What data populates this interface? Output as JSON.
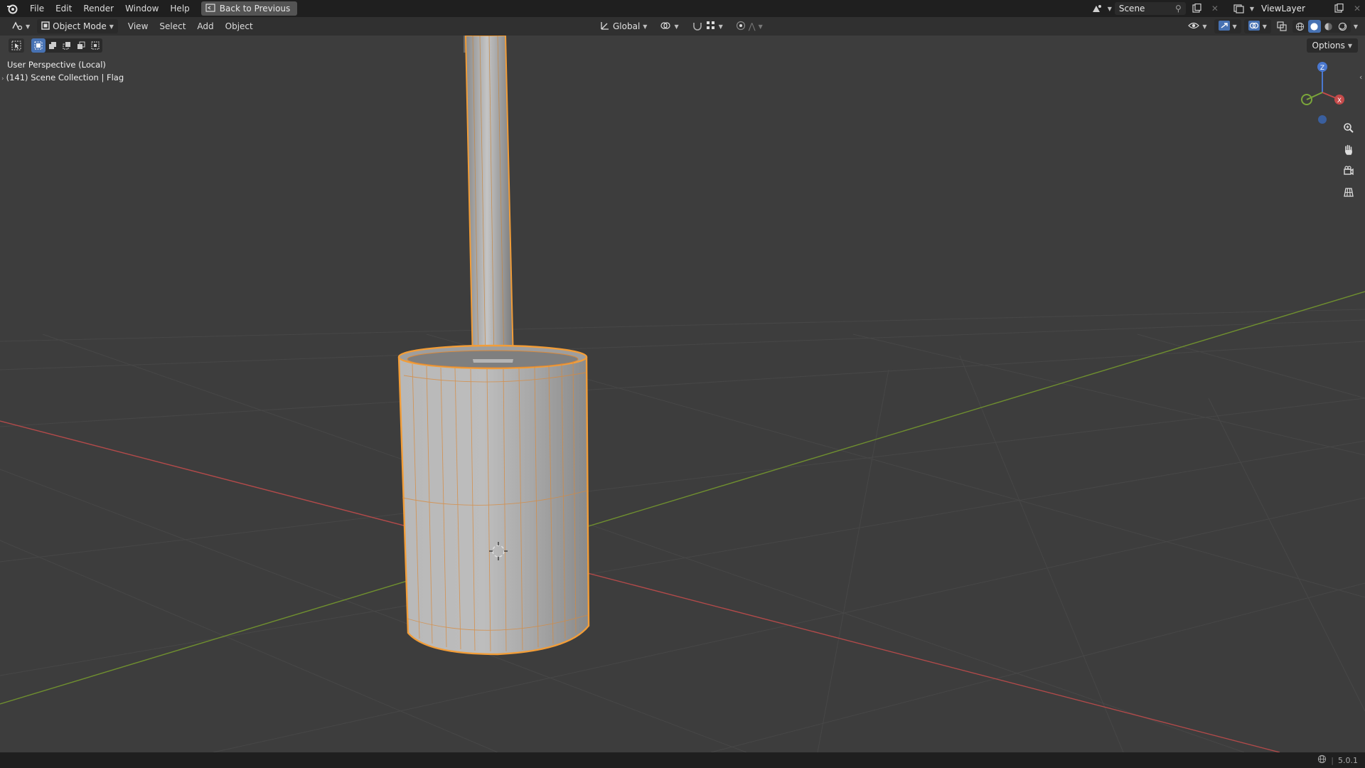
{
  "topbar": {
    "menus": [
      "File",
      "Edit",
      "Render",
      "Window",
      "Help"
    ],
    "back_label": "Back to Previous",
    "scene_name": "Scene",
    "view_layer": "ViewLayer"
  },
  "header": {
    "mode": "Object Mode",
    "menus": [
      "View",
      "Select",
      "Add",
      "Object"
    ],
    "orientation": "Global"
  },
  "viewport": {
    "perspective": "User Perspective (Local)",
    "collection": "(141) Scene Collection | Flag",
    "options_label": "Options",
    "gizmo": {
      "z": "Z",
      "x": "X"
    }
  },
  "status": {
    "version": "5.0.1"
  },
  "colors": {
    "accent_selection": "#f29d38",
    "axis_x": "#b24a4a",
    "axis_y": "#6f8f2f",
    "active_blue": "#4772b3",
    "viewport_bg": "#3d3d3d"
  },
  "icons": [
    "blender-logo-icon",
    "back-icon",
    "editor-type-icon",
    "object-mode-icon",
    "transform-orientation-icon",
    "snap-icon",
    "proportional-edit-icon",
    "zoom-icon",
    "pan-hand-icon",
    "camera-icon",
    "grid-view-icon",
    "globe-icon"
  ]
}
